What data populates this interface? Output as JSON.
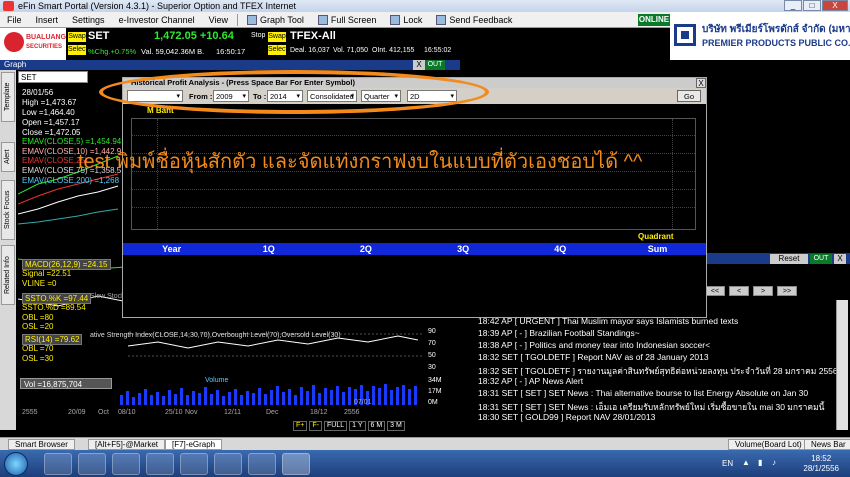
{
  "window": {
    "title": "eFin Smart Portal (Version 4.3.1) - Superior Option and TFEX Internet",
    "minimize": "_",
    "maximize": "□",
    "close": "X"
  },
  "menu": {
    "items": [
      "File",
      "Insert",
      "Settings",
      "e-Investor Channel",
      "View",
      "Graph Tool",
      "Full Screen",
      "Lock",
      "Send Feedback"
    ],
    "online": "ONLINE"
  },
  "logos": {
    "broker_line1": "BUALUANG",
    "broker_line2": "SECURITIES",
    "company_thai": "บริษัท พรีเมียร์โพรดักส์ จำกัด (มหาชน)",
    "company_en": "PREMIER PRODUCTS PUBLIC CO.,LTD."
  },
  "ticker_set": {
    "swap": "Swap",
    "select": "Select",
    "symbol": "SET",
    "price": "1,472.05 +10.64",
    "pct": "%Chg.+0.75%",
    "vol": "Val. 59,042.36M B.",
    "time": "16:50:17"
  },
  "ticker_tfex": {
    "stop": "Stop",
    "swap": "Swap",
    "select": "Select",
    "symbol": "TFEX-All",
    "deal": "Deal. 16,037",
    "vol": "Vol. 71,050",
    "oint": "OInt. 412,155",
    "time": "16:55:02"
  },
  "graph": {
    "title": "Graph",
    "close": "X",
    "out": "OUT",
    "symbol": "SET",
    "date": "28/01/56",
    "high": "High =1,473.67",
    "low": "Low =1,464.40",
    "open": "Open =1,457.17",
    "close_val": "Close =1,472.05",
    "ema5": "EMAV(CLOSE,5) =1,454.94",
    "ema10": "EMAV(CLOSE,10) =1,442.9",
    "ema25": "EMAV(CLOSE,25)",
    "ema75": "EMAV(CLOSE,75) =1,358.5",
    "ema200": "EMAV(CLOSE,200) =1,268",
    "macd": "MACD(26,12,9) =24.15",
    "signal": "Signal =22.51",
    "vline": "VLINE =0",
    "ssto_k": "SSTO.%K =97.44",
    "ssto_d": "SSTO.%D =89.54",
    "obl": "OBL =80",
    "osl": "OSL =20",
    "stoch_label": "Slow Stoch",
    "rsi": "RSI(14) =79.62",
    "rsi_obl": "OBL =70",
    "rsi_osl": "OSL =30",
    "rsi_label": "ative Strength Index(CLOSE,14,30,70),Overbought Level(70),Oversold Level(30)",
    "vol": "Vol =16,875,704",
    "volume_label": "Volume",
    "vol_axis": [
      "34M",
      "17M",
      "0M"
    ],
    "rsi_axis": [
      "90",
      "70",
      "50",
      "30"
    ],
    "dates": [
      "2555",
      "20/09",
      "Oct",
      "08/10",
      "25/10",
      "Nov",
      "12/11",
      "Dec",
      "18/12",
      "2556",
      "07/01"
    ],
    "toolbar": [
      "F+",
      "F-",
      "FULL",
      "1 Y",
      "6 M",
      "3 M"
    ]
  },
  "left_tabs": [
    "Template",
    "Alert",
    "Stock Focus",
    "Related Info"
  ],
  "dialog": {
    "title": "Historical Profit Analysis - (Press Space Bar For Enter Symbol)",
    "close": "X",
    "from_label": "From :",
    "from_value": "2009",
    "to_label": "To :",
    "to_value": "2014",
    "consolidated": "Consolidated",
    "quarter": "Quarter",
    "view": "2D",
    "go": "Go",
    "unit": "M Baht",
    "quadrant": "Quadrant",
    "columns": [
      "Year",
      "1Q",
      "2Q",
      "3Q",
      "4Q",
      "Sum"
    ]
  },
  "overlay_text": "test พิมพ์ชื่อหุ้นสักตัว และจัดแท่งกราฟงบในแบบที่ตัวเองชอบได้ ^^",
  "news": {
    "reset": "Reset",
    "out": "OUT",
    "close": "X",
    "nav": [
      "<<",
      "<",
      ">",
      ">>"
    ],
    "top_fragment": "pace",
    "rows": [
      "18:42 AP [ URGENT ] Thai Muslim mayor says Islamists burned texts",
      "18:39 AP [ - ] Brazilian Football Standings~",
      "18:38 AP [ - ] Politics and money tear into Indonesian soccer<",
      "18:32 SET [ TGOLDETF ] Report NAV as of 28 January 2013",
      "18:32 SET [ TGOLDETF ] รายงานมูลค่าสินทรัพย์สุทธิต่อหน่วยลงทุน ประจำวันที่ 28 มกราคม 2556",
      "18:32 AP [ - ] AP News Alert",
      "18:31 SET [ SET ] SET News : Thai alternative bourse to list Energy Absolute on Jan 30",
      "18:31 SET [ SET ] SET News : เอ็มเอ เตรียมรับหลักทรัพย์ใหม่ เริ่มซื้อขายใน mai 30 มกราคมนี้",
      "18:30 SET [ GOLD99 ] Report NAV 28/01/2013"
    ]
  },
  "bottom_tabs": [
    "Smart Browser",
    "[Alt+F5]-@Market",
    "[F7]-eGraph",
    "Volume(Board Lot)",
    "News Bar"
  ],
  "taskbar": {
    "lang": "EN",
    "time": "18:52",
    "date": "28/1/2556"
  }
}
